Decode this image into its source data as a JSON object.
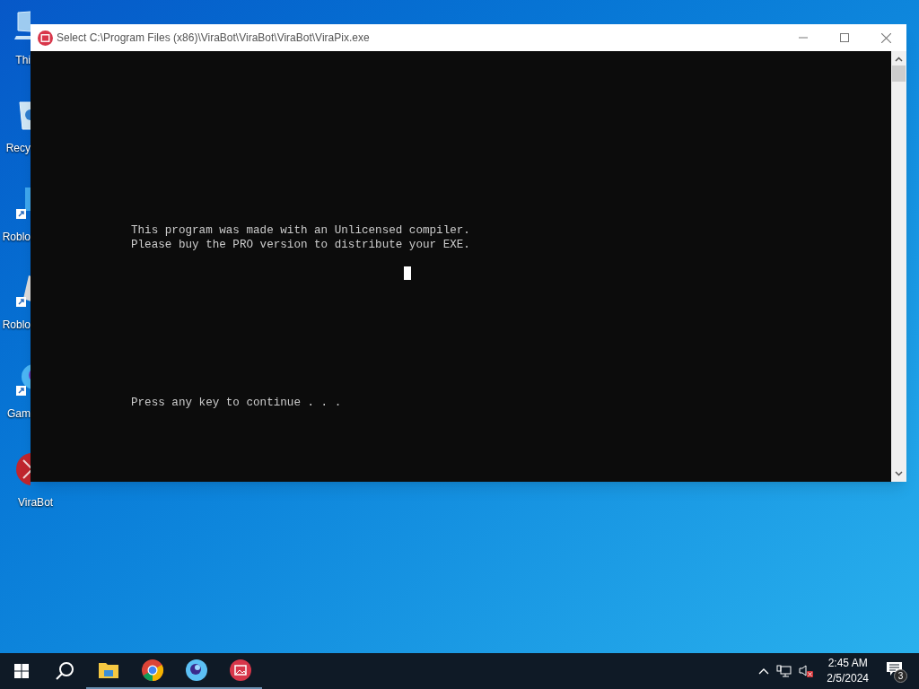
{
  "desktop_icons": [
    {
      "label": "Thi",
      "kind": "monitor"
    },
    {
      "label": "Recy",
      "kind": "bin"
    },
    {
      "label": "Roblo",
      "kind": "shortcut-blue"
    },
    {
      "label": "Roblo",
      "kind": "shortcut-gray"
    },
    {
      "label": "Gam",
      "kind": "shortcut-orb"
    },
    {
      "label": "ViraBot",
      "kind": "virabot"
    }
  ],
  "window": {
    "title": "Select C:\\Program Files (x86)\\ViraBot\\ViraBot\\ViraBot\\ViraPix.exe"
  },
  "console": {
    "lines": [
      "This program was made with an Unlicensed compiler.",
      "Please buy the PRO version to distribute your EXE."
    ],
    "prompt": "Press any key to continue . . ."
  },
  "taskbar": {
    "apps": [
      {
        "kind": "folder"
      },
      {
        "kind": "chrome"
      },
      {
        "kind": "orb"
      },
      {
        "kind": "virapix"
      }
    ],
    "time": "2:45 AM",
    "date": "2/5/2024",
    "notifications": "3"
  }
}
